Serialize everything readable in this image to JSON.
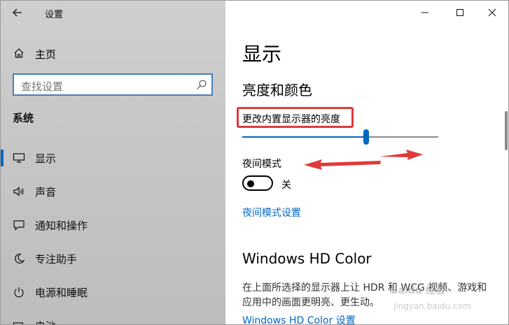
{
  "window": {
    "title": "设置"
  },
  "sidebar": {
    "home_label": "主页",
    "search_placeholder": "查找设置",
    "section_title": "系统",
    "items": [
      {
        "label": "显示",
        "icon": "monitor-icon",
        "selected": true
      },
      {
        "label": "声音",
        "icon": "speaker-icon",
        "selected": false
      },
      {
        "label": "通知和操作",
        "icon": "message-icon",
        "selected": false
      },
      {
        "label": "专注助手",
        "icon": "moon-icon",
        "selected": false
      },
      {
        "label": "电源和睡眠",
        "icon": "power-icon",
        "selected": false
      },
      {
        "label": "电池",
        "icon": "battery-icon",
        "selected": false
      }
    ]
  },
  "main": {
    "page_title": "显示",
    "section_title": "亮度和颜色",
    "brightness_label": "更改内置显示器的亮度",
    "brightness_value": 0.64,
    "night_light_label": "夜间模式",
    "night_light_state": "关",
    "night_light_on": false,
    "night_light_link": "夜间模式设置",
    "hd_color_title": "Windows HD Color",
    "hd_color_desc": "在上面所选择的显示器上让 HDR 和 WCG 视频、游戏和应用中的画面更明亮、更生动。",
    "hd_color_link": "Windows HD Color 设置"
  },
  "annotations": {
    "highlight_color": "#e0393b",
    "arrow_color": "#e0393b"
  },
  "watermark": {
    "line1": "Baidu 经验",
    "line2": "jingyan.baidu.com"
  },
  "colors": {
    "accent": "#0067c0",
    "sidebar_bg": "#c8c8c8"
  }
}
